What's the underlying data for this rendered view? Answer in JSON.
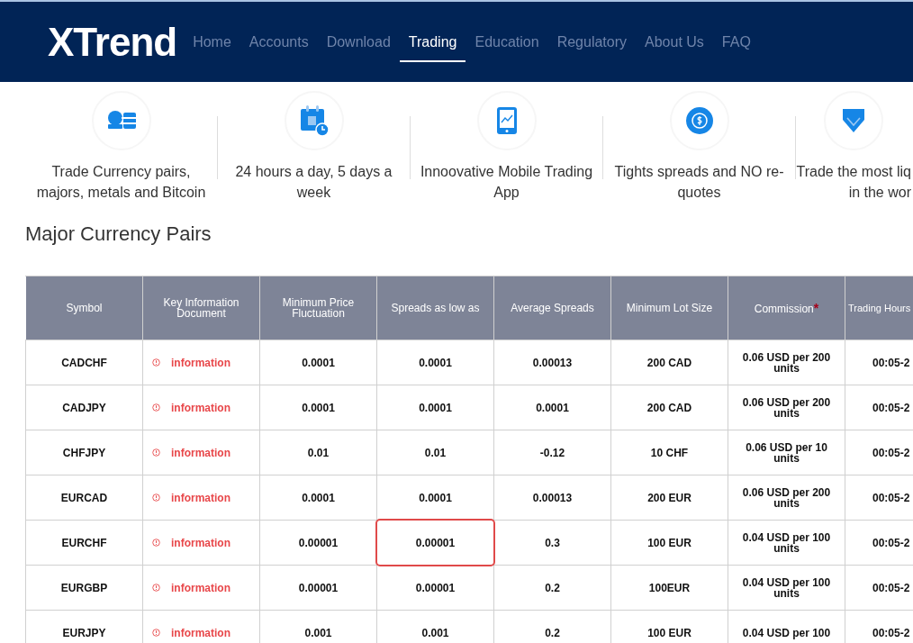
{
  "logo": "XTrend",
  "nav": [
    {
      "label": "Home",
      "selected": false
    },
    {
      "label": "Accounts",
      "selected": false
    },
    {
      "label": "Download",
      "selected": false
    },
    {
      "label": "Trading",
      "selected": true
    },
    {
      "label": "Education",
      "selected": false
    },
    {
      "label": "Regulatory",
      "selected": false
    },
    {
      "label": "About Us",
      "selected": false
    },
    {
      "label": "FAQ",
      "selected": false
    }
  ],
  "features": [
    {
      "kind": "coins",
      "lines": [
        "Trade Currency pairs,",
        "majors, metals and Bitcoin"
      ]
    },
    {
      "kind": "calendar",
      "lines": [
        "24 hours a day, 5 days a",
        "week"
      ]
    },
    {
      "kind": "tablet",
      "lines": [
        "Innoovative Mobile Trading",
        "App"
      ]
    },
    {
      "kind": "dollar",
      "lines": [
        "Tights spreads and NO re-",
        "quotes"
      ]
    },
    {
      "kind": "diamond",
      "lines": [
        "Trade the most liq",
        "in the wor"
      ]
    }
  ],
  "section_title": "Major Currency Pairs",
  "table": {
    "columns": [
      {
        "label": "Symbol"
      },
      {
        "label": "Key Information Document"
      },
      {
        "label": "Minimum Price Fluctuation"
      },
      {
        "label": "Spreads as low as"
      },
      {
        "label": "Average Spreads"
      },
      {
        "label": "Minimum Lot Size"
      },
      {
        "label": "Commission",
        "note_mark": "*"
      },
      {
        "label": "Trading Hours"
      }
    ],
    "rows": [
      {
        "symbol": "CADCHF",
        "document": "information",
        "min_fluctuation": "0.0001",
        "spreads_low": "0.0001",
        "spreads_highlighted": false,
        "average_spreads": "0.00013",
        "min_lot": "200 CAD",
        "commission": "0.06 USD per 200 units",
        "hours": "00:05-2"
      },
      {
        "symbol": "CADJPY",
        "document": "information",
        "min_fluctuation": "0.0001",
        "spreads_low": "0.0001",
        "spreads_highlighted": false,
        "average_spreads": "0.0001",
        "min_lot": "200 CAD",
        "commission": "0.06 USD per 200 units",
        "hours": "00:05-2"
      },
      {
        "symbol": "CHFJPY",
        "document": "information",
        "min_fluctuation": "0.01",
        "spreads_low": "0.01",
        "spreads_highlighted": false,
        "average_spreads": "-0.12",
        "min_lot": "10 CHF",
        "commission": "0.06 USD per 10 units",
        "hours": "00:05-2"
      },
      {
        "symbol": "EURCAD",
        "document": "information",
        "min_fluctuation": "0.0001",
        "spreads_low": "0.0001",
        "spreads_highlighted": false,
        "average_spreads": "0.00013",
        "min_lot": "200 EUR",
        "commission": "0.06 USD per 200 units",
        "hours": "00:05-2"
      },
      {
        "symbol": "EURCHF",
        "document": "information",
        "min_fluctuation": "0.00001",
        "spreads_low": "0.00001",
        "spreads_highlighted": true,
        "average_spreads": "0.3",
        "min_lot": "100 EUR",
        "commission": "0.04 USD per 100 units",
        "hours": "00:05-2"
      },
      {
        "symbol": "EURGBP",
        "document": "information",
        "min_fluctuation": "0.00001",
        "spreads_low": "0.00001",
        "spreads_highlighted": false,
        "average_spreads": "0.2",
        "min_lot": "100EUR",
        "commission": "0.04 USD per 100 units",
        "hours": "00:05-2"
      },
      {
        "symbol": "EURJPY",
        "document": "information",
        "min_fluctuation": "0.001",
        "spreads_low": "0.001",
        "spreads_highlighted": false,
        "average_spreads": "0.2",
        "min_lot": "100 EUR",
        "commission": "0.04 USD per 100",
        "hours": "00:05-2"
      }
    ]
  }
}
